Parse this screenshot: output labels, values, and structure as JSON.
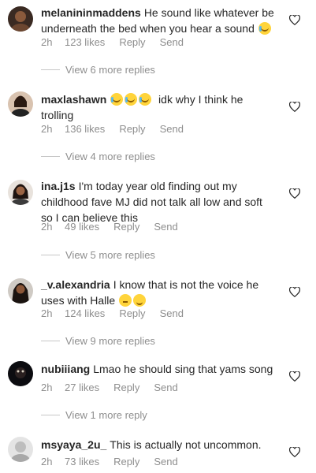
{
  "comments": [
    {
      "username": "melanininmaddens",
      "text": "He sound like whatever be underneath the bed when you hear a sound",
      "emoji": "crying-laughing",
      "time": "2h",
      "likes": "123 likes",
      "reply": "Reply",
      "send": "Send",
      "view_more": "View 6 more replies"
    },
    {
      "username": "maxlashawn",
      "text": "idk why I think he trolling",
      "emoji": "crying-laughing x3",
      "time": "2h",
      "likes": "136 likes",
      "reply": "Reply",
      "send": "Send",
      "view_more": "View 4 more replies"
    },
    {
      "username": "ina.j1s",
      "text": "I'm today year old finding out my childhood fave MJ did not talk all low and soft so I can believe this",
      "time": "2h",
      "likes": "49 likes",
      "reply": "Reply",
      "send": "Send",
      "view_more": "View 5 more replies"
    },
    {
      "username": "_v.alexandria",
      "text": "I know that is not the voice he uses with Halle",
      "emoji": "flushed, zany",
      "time": "2h",
      "likes": "124 likes",
      "reply": "Reply",
      "send": "Send",
      "view_more": "View 9 more replies"
    },
    {
      "username": "nubiiiang",
      "text": "Lmao he should sing that yams song",
      "time": "2h",
      "likes": "27 likes",
      "reply": "Reply",
      "send": "Send",
      "view_more": "View 1 more reply"
    },
    {
      "username": "msyaya_2u_",
      "text": "This is actually not uncommon.",
      "time": "2h",
      "likes": "73 likes",
      "reply": "Reply",
      "send": "Send"
    }
  ],
  "icons": {
    "like": "heart-outline-icon",
    "emoji_color": "#ffd43b"
  },
  "colors": {
    "text": "#262626",
    "meta": "#8e8e8e",
    "background": "#ffffff"
  }
}
